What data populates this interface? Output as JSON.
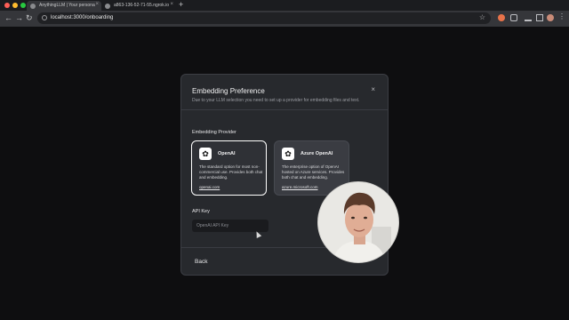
{
  "browser": {
    "tabs": [
      {
        "label": "AnythingLLM | Your persona"
      },
      {
        "label": "a863-136-52-71-55.ngrok.io"
      }
    ],
    "new_tab": "+",
    "url": "localhost:3000/onboarding"
  },
  "modal": {
    "title": "Embedding Preference",
    "subtitle": "Due to your LLM selection you need to set up a provider for embedding files and text.",
    "close": "×",
    "section_label": "Embedding Provider",
    "providers": [
      {
        "name": "OpenAI",
        "description": "The standard option for most non-commercial use. Provides both chat and embedding.",
        "link": "openai.com",
        "selected": true
      },
      {
        "name": "Azure OpenAI",
        "description": "The enterprise option of OpenAI hosted on Azure services. Provides both chat and embedding.",
        "link": "azure.microsoft.com",
        "selected": false
      }
    ],
    "api_key_label": "API Key",
    "api_key_placeholder": "OpenAI API Key",
    "api_key_value": "",
    "back_label": "Back"
  },
  "colors": {
    "page_bg": "#0e0e10",
    "modal_bg": "#27292d",
    "selected_border": "#ffffff"
  }
}
